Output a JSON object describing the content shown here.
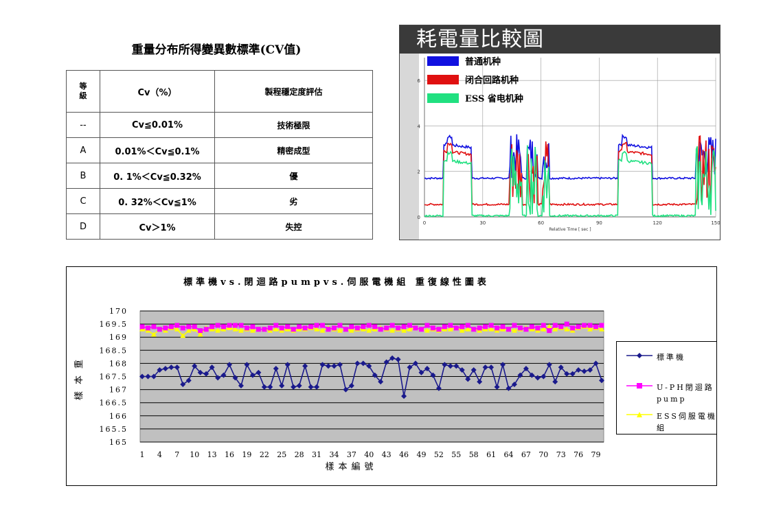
{
  "cv_table": {
    "title": "重量分布所得變異數標準(CV值)",
    "headers": [
      "等\n級",
      "Cv（%）",
      "製程穩定度評估"
    ],
    "rows": [
      [
        "--",
        "Cv≦0.01%",
        "技術極限"
      ],
      [
        "A",
        "0.01%＜Cv≦0.1%",
        "精密成型"
      ],
      [
        "B",
        "0. 1%＜Cv≦0.32%",
        "優"
      ],
      [
        "C",
        "0. 32%＜Cv≦1%",
        "劣"
      ],
      [
        "D",
        "Cv＞1%",
        "失控"
      ]
    ]
  },
  "chart_data": [
    {
      "type": "line",
      "title": "耗電量比較圖",
      "xlabel": "Relative Time [ sec ]",
      "ylabel": "",
      "xlim": [
        0,
        150
      ],
      "ylim": [
        0,
        7
      ],
      "x_ticks": [
        0,
        30,
        60,
        90,
        120,
        150
      ],
      "y_ticks": [
        0,
        2,
        4,
        6
      ],
      "legend_position": "top-left",
      "series": [
        {
          "name": "普通机种",
          "color": "#1010e0",
          "base": 1.7,
          "peak": 3.2
        },
        {
          "name": "闭合回路机种",
          "color": "#e01010",
          "base": 0.55,
          "peak": 2.9
        },
        {
          "name": "ESS 省电机种",
          "color": "#20e080",
          "base": 0.05,
          "peak": 2.5
        }
      ]
    },
    {
      "type": "line",
      "title": "標準機vs.閉迴路pumpvs.伺服電機組 重復線性圖表",
      "xlabel": "樣本編號",
      "ylabel": "樣本重",
      "ylim": [
        165,
        170
      ],
      "y_ticks": [
        165,
        165.5,
        166,
        166.5,
        167,
        167.5,
        168,
        168.5,
        169,
        169.5,
        170
      ],
      "y_tick_labels": [
        "165",
        "165.5",
        "166",
        "166.5",
        "167",
        "167.5",
        "168",
        "168.5",
        "169",
        "169.5",
        "170"
      ],
      "x_tick_labels": [
        "1",
        "4",
        "7",
        "10",
        "13",
        "16",
        "19",
        "22",
        "25",
        "28",
        "31",
        "34",
        "37",
        "40",
        "43",
        "46",
        "49",
        "52",
        "55",
        "58",
        "61",
        "64",
        "67",
        "70",
        "73",
        "76",
        "79"
      ],
      "legend_position": "right",
      "colors": {
        "plot_bg": "#c0c0c0",
        "series1": "#1a1a8c",
        "series2": "#ff00ff",
        "series3": "#ffff00"
      },
      "series": [
        {
          "name": "標準機",
          "marker": "diamond",
          "values": [
            167.5,
            167.5,
            167.5,
            167.75,
            167.8,
            167.85,
            167.85,
            167.2,
            167.35,
            167.9,
            167.65,
            167.6,
            167.85,
            167.45,
            167.55,
            167.95,
            167.45,
            167.15,
            167.95,
            167.55,
            167.65,
            167.1,
            167.1,
            167.8,
            167.15,
            167.95,
            167.1,
            167.15,
            167.9,
            167.1,
            167.1,
            167.95,
            167.9,
            167.9,
            167.95,
            167.0,
            167.15,
            168.0,
            168.0,
            167.9,
            167.55,
            167.3,
            168.05,
            168.2,
            168.15,
            166.75,
            167.85,
            168.0,
            167.65,
            167.8,
            167.55,
            167.05,
            167.95,
            167.9,
            167.9,
            167.75,
            167.4,
            167.75,
            167.3,
            167.85,
            167.85,
            167.1,
            167.95,
            167.05,
            167.2,
            167.55,
            167.8,
            167.55,
            167.45,
            167.5,
            167.95,
            167.3,
            167.85,
            167.6,
            167.6,
            167.75,
            167.7,
            167.75,
            168.0,
            167.35
          ]
        },
        {
          "name": "U-PH閉迴路pump",
          "marker": "square",
          "values": [
            169.4,
            169.35,
            169.4,
            169.3,
            169.35,
            169.4,
            169.45,
            169.35,
            169.4,
            169.4,
            169.25,
            169.3,
            169.4,
            169.45,
            169.4,
            169.45,
            169.45,
            169.45,
            169.35,
            169.4,
            169.3,
            169.3,
            169.35,
            169.45,
            169.35,
            169.4,
            169.3,
            169.4,
            169.35,
            169.4,
            169.45,
            169.45,
            169.3,
            169.35,
            169.45,
            169.3,
            169.4,
            169.35,
            169.4,
            169.45,
            169.4,
            169.3,
            169.35,
            169.45,
            169.35,
            169.4,
            169.45,
            169.35,
            169.3,
            169.45,
            169.35,
            169.3,
            169.4,
            169.45,
            169.35,
            169.4,
            169.45,
            169.3,
            169.35,
            169.4,
            169.45,
            169.35,
            169.4,
            169.3,
            169.45,
            169.35,
            169.3,
            169.4,
            169.35,
            169.45,
            169.25,
            169.45,
            169.4,
            169.5,
            169.35,
            169.4,
            169.45,
            169.45,
            169.4,
            169.45
          ]
        },
        {
          "name": "ESS伺服電機組",
          "marker": "triangle",
          "values": [
            169.3,
            169.25,
            169.1,
            169.3,
            169.25,
            169.35,
            169.3,
            169.05,
            169.25,
            169.3,
            169.1,
            169.35,
            169.3,
            169.25,
            169.3,
            169.35,
            169.3,
            169.25,
            169.3,
            169.25,
            169.3,
            169.3,
            169.25,
            169.3,
            169.25,
            169.3,
            169.25,
            169.3,
            169.3,
            169.35,
            169.3,
            169.25,
            169.35,
            169.3,
            169.25,
            169.3,
            169.25,
            169.3,
            169.3,
            169.25,
            169.3,
            169.35,
            169.3,
            169.25,
            169.3,
            169.25,
            169.3,
            169.35,
            169.3,
            169.25,
            169.3,
            169.25,
            169.3,
            169.3,
            169.35,
            169.25,
            169.3,
            169.3,
            169.25,
            169.3,
            169.3,
            169.25,
            169.3,
            169.3,
            169.25,
            169.3,
            169.35,
            169.3,
            169.25,
            169.3,
            169.4,
            169.3,
            169.35,
            169.3,
            169.25,
            169.35,
            169.4,
            169.3,
            169.35,
            169.3
          ]
        }
      ]
    }
  ]
}
